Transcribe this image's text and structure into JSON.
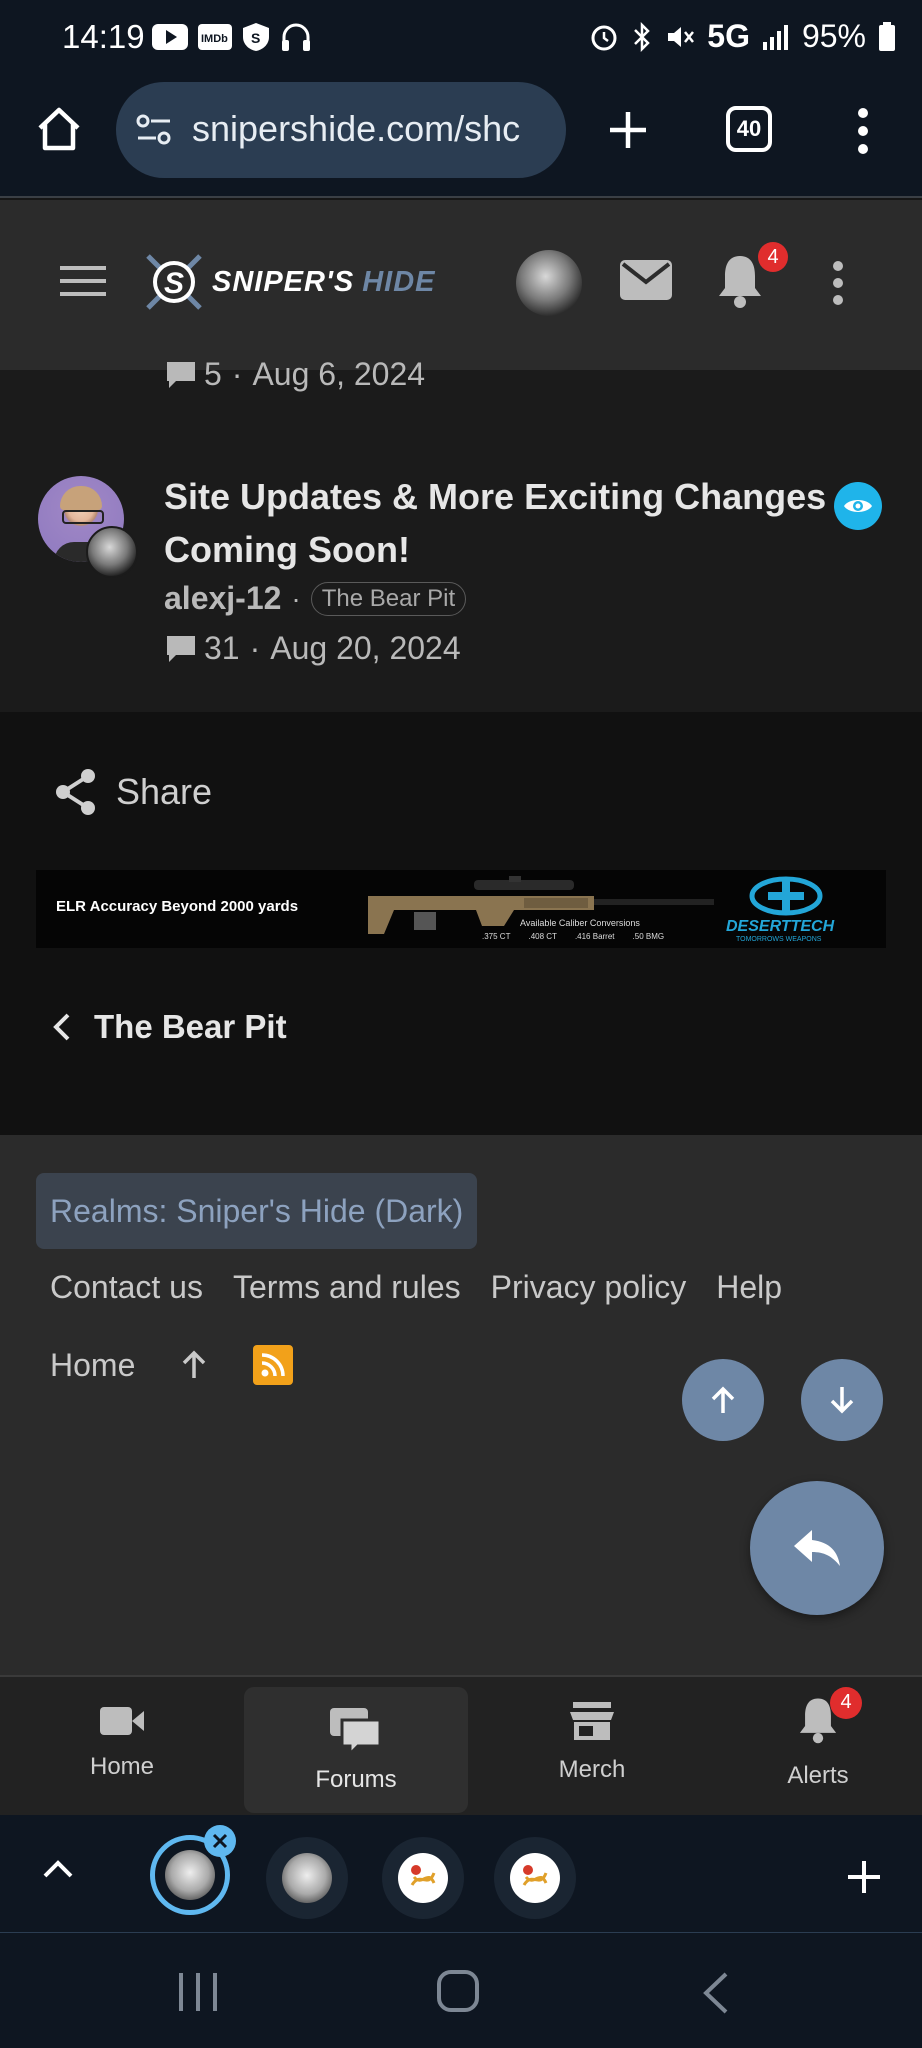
{
  "status_bar": {
    "time": "14:19",
    "network": "5G",
    "battery": "95%",
    "left_icons": [
      "youtube-icon",
      "imdb-icon",
      "shield-s-icon",
      "headphones-icon"
    ],
    "right_icons": [
      "alarm-icon",
      "bluetooth-icon",
      "mute-icon",
      "signal-icon",
      "battery-icon"
    ]
  },
  "browser": {
    "url": "snipershide.com/shc",
    "tab_count": "40"
  },
  "site_header": {
    "logo_text_primary": "SNIPER'S",
    "logo_text_secondary": "HIDE",
    "notification_count": "4"
  },
  "thread_prev": {
    "replies": "5",
    "date": "Aug 6, 2024"
  },
  "thread": {
    "title_line1": "Site Updates & More Exciting Changes",
    "title_line2": "Coming Soon!",
    "author": "alexj-12",
    "forum_tag": "The Bear Pit",
    "replies": "31",
    "date": "Aug 20, 2024"
  },
  "share": {
    "label": "Share"
  },
  "ad": {
    "headline": "ELR Accuracy Beyond 2000 yards",
    "subline": "Available Caliber Conversions",
    "calibers": [
      ".375 CT",
      ".408 CT",
      ".416 Barret",
      ".50 BMG"
    ],
    "brand": "DESERTTECH",
    "brand_sub": "TOMORROWS WEAPONS"
  },
  "back_link": {
    "label": "The Bear Pit"
  },
  "footer": {
    "style_chooser": "Realms: Sniper's Hide (Dark)",
    "links": [
      "Contact us",
      "Terms and rules",
      "Privacy policy",
      "Help"
    ],
    "home": "Home"
  },
  "bottom_nav": [
    {
      "label": "Home",
      "icon": "video-camera-icon"
    },
    {
      "label": "Forums",
      "icon": "chat-bubbles-icon"
    },
    {
      "label": "Merch",
      "icon": "store-icon"
    },
    {
      "label": "Alerts",
      "icon": "bell-icon",
      "badge": "4"
    }
  ],
  "colors": {
    "accent": "#6e87a6",
    "badge_red": "#e02d2d",
    "watch_blue": "#1fb4ea",
    "rss_orange": "#f2a11a"
  }
}
